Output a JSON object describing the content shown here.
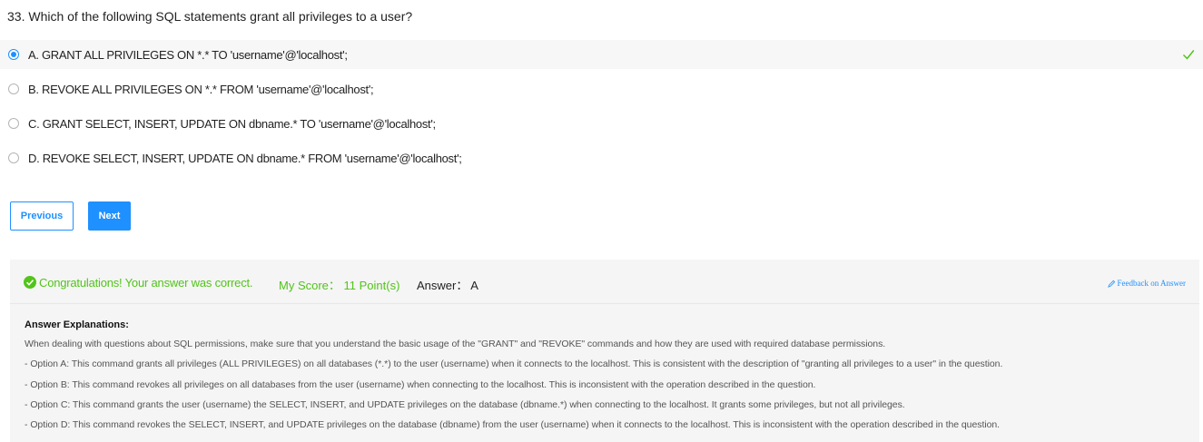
{
  "question": {
    "text": "33. Which of the following SQL statements grant all privileges to a user?"
  },
  "options": [
    {
      "label": "A. GRANT ALL PRIVILEGES ON *.* TO 'username'@'localhost';",
      "selected": true,
      "correct": true
    },
    {
      "label": "B. REVOKE ALL PRIVILEGES ON *.* FROM 'username'@'localhost';",
      "selected": false
    },
    {
      "label": "C. GRANT SELECT, INSERT, UPDATE ON dbname.* TO 'username'@'localhost';",
      "selected": false
    },
    {
      "label": "D. REVOKE SELECT, INSERT, UPDATE ON dbname.* FROM 'username'@'localhost';",
      "selected": false
    }
  ],
  "nav": {
    "previous_label": "Previous",
    "next_label": "Next"
  },
  "result": {
    "congrats": "Congratulations! Your answer was correct.",
    "score": "My Score： 11 Point(s)",
    "answer": "Answer： A",
    "feedback_label": "Feedback on Answer"
  },
  "explanation": {
    "title": "Answer Explanations:",
    "lines": [
      "When dealing with questions about SQL permissions, make sure that you understand the basic usage of the \"GRANT\" and \"REVOKE\" commands and how they are used with required database permissions.",
      "- Option A: This command grants all privileges (ALL PRIVILEGES) on all databases (*.*) to the user (username) when it connects to the localhost. This is consistent with the description of \"granting all privileges to a user\" in the question.",
      "- Option B: This command revokes all privileges on all databases from the user (username) when connecting to the localhost. This is inconsistent with the operation described in the question.",
      "- Option C: This command grants the user (username) the SELECT, INSERT, and UPDATE privileges on the database (dbname.*) when connecting to the localhost. It grants some privileges, but not all privileges.",
      "- Option D: This command revokes the SELECT, INSERT, and UPDATE privileges on the database (dbname) from the user (username) when it connects to the localhost. This is inconsistent with the operation described in the question."
    ]
  },
  "colors": {
    "accent": "#1e90ff",
    "success": "#52c41a"
  },
  "icons": {
    "correct": "checkmark-icon",
    "result": "check-circle-icon",
    "feedback": "edit-icon"
  }
}
